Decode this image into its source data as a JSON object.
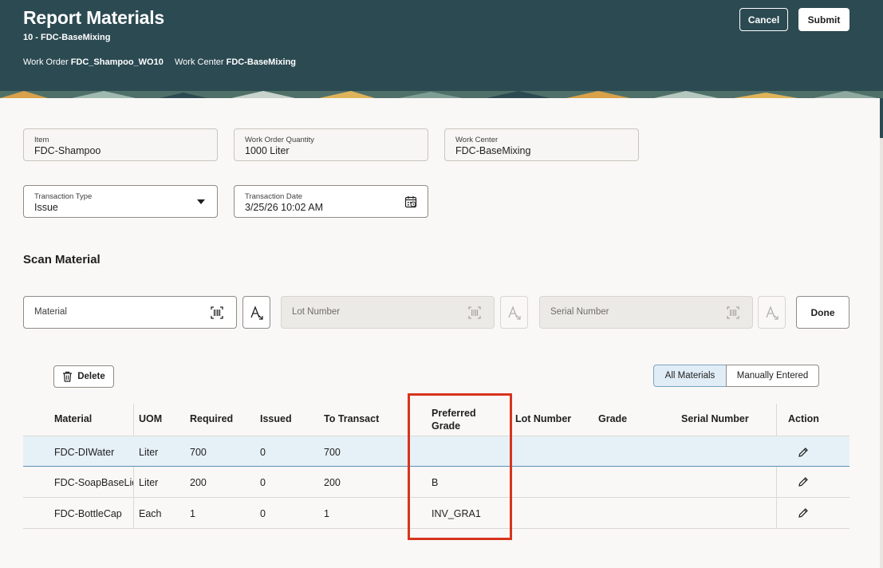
{
  "header": {
    "title": "Report Materials",
    "subtitle": "10 - FDC-BaseMixing",
    "work_order_label": "Work Order",
    "work_order_value": "FDC_Shampoo_WO10",
    "work_center_label": "Work Center",
    "work_center_value": "FDC-BaseMixing",
    "cancel_label": "Cancel",
    "submit_label": "Submit"
  },
  "fields": {
    "item": {
      "label": "Item",
      "value": "FDC-Shampoo"
    },
    "work_order_quantity": {
      "label": "Work Order Quantity",
      "value": "1000 Liter"
    },
    "work_center": {
      "label": "Work Center",
      "value": "FDC-BaseMixing"
    },
    "transaction_type": {
      "label": "Transaction Type",
      "value": "Issue"
    },
    "transaction_date": {
      "label": "Transaction Date",
      "value": "3/25/26 10:02 AM"
    }
  },
  "scan": {
    "title": "Scan Material",
    "material_placeholder": "Material",
    "lot_placeholder": "Lot Number",
    "serial_placeholder": "Serial Number",
    "done_label": "Done"
  },
  "toolbar": {
    "delete_label": "Delete",
    "all_materials_label": "All Materials",
    "manually_entered_label": "Manually Entered"
  },
  "table": {
    "columns": [
      "Material",
      "UOM",
      "Required",
      "Issued",
      "To Transact",
      "Preferred Grade",
      "Lot Number",
      "Grade",
      "Serial Number",
      "Action"
    ],
    "preferred_grade_line1": "Preferred",
    "preferred_grade_line2": "Grade",
    "rows": [
      {
        "material": "FDC-DIWater",
        "uom": "Liter",
        "required": "700",
        "issued": "0",
        "to_transact": "700",
        "preferred_grade": "",
        "lot": "",
        "grade": "",
        "serial": ""
      },
      {
        "material": "FDC-SoapBaseLiquid",
        "uom": "Liter",
        "required": "200",
        "issued": "0",
        "to_transact": "200",
        "preferred_grade": "B",
        "lot": "",
        "grade": "",
        "serial": ""
      },
      {
        "material": "FDC-BottleCap",
        "uom": "Each",
        "required": "1",
        "issued": "0",
        "to_transact": "1",
        "preferred_grade": "INV_GRA1",
        "lot": "",
        "grade": "",
        "serial": ""
      }
    ]
  },
  "colors": {
    "header_bg": "#2c4a52",
    "selected_row": "#e6f0f7",
    "highlight": "#d8331d"
  }
}
